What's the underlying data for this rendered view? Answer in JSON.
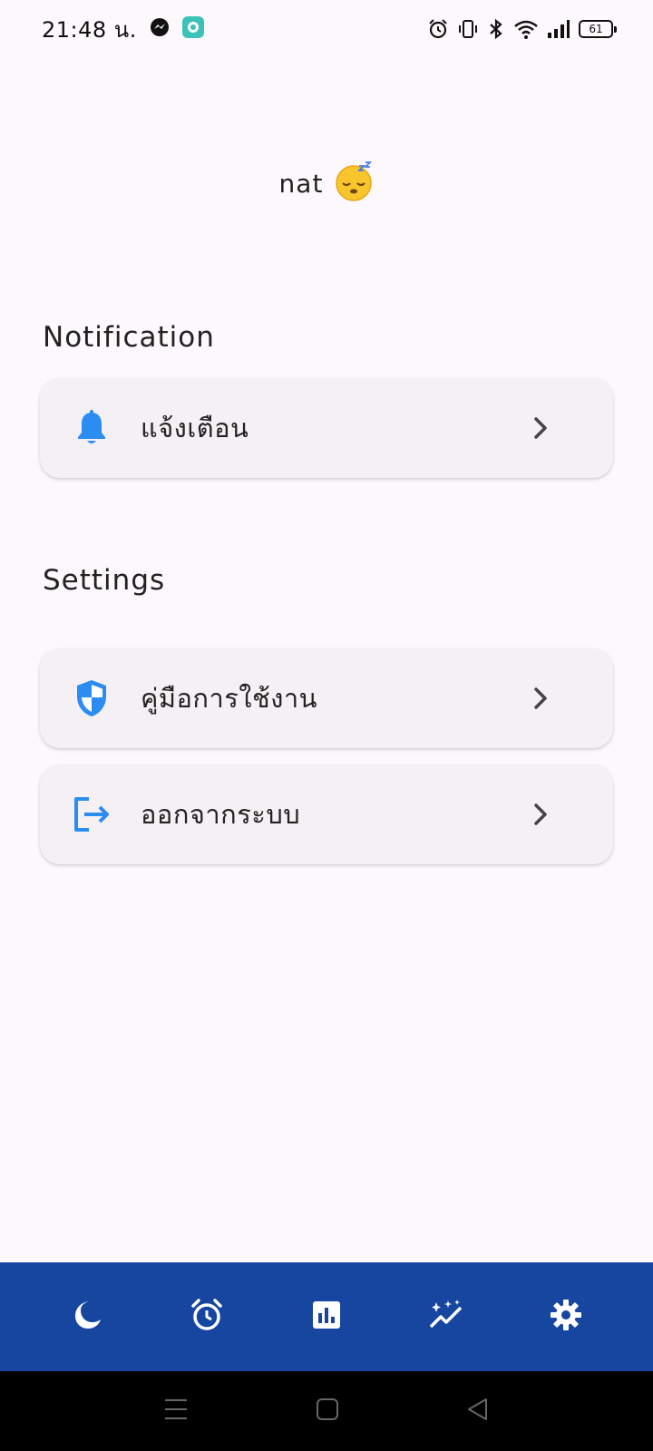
{
  "status_bar": {
    "time": "21:48 น.",
    "battery": "61",
    "icons": [
      "messenger-icon",
      "chat-app-icon",
      "alarm-icon",
      "vibrate-icon",
      "bluetooth-icon",
      "wifi-icon",
      "signal-icon",
      "battery-icon"
    ]
  },
  "profile": {
    "name": "nat",
    "emoji": "😴"
  },
  "notification_section": {
    "heading": "Notification",
    "items": [
      {
        "label": "แจ้งเตือน",
        "icon": "bell-icon"
      }
    ]
  },
  "settings_section": {
    "heading": "Settings",
    "items": [
      {
        "label": "คู่มือการใช้งาน",
        "icon": "shield-icon"
      },
      {
        "label": "ออกจากระบบ",
        "icon": "logout-icon"
      }
    ]
  },
  "bottom_nav": {
    "items": [
      "moon-icon",
      "alarm-clock-icon",
      "bar-chart-icon",
      "trending-sparkle-icon",
      "settings-gear-icon"
    ],
    "active": "settings-gear-icon"
  },
  "colors": {
    "accent": "#2c8df0",
    "nav_background": "#1646a0",
    "page_background": "#fdf8fc",
    "card_background": "#f4f0f4"
  }
}
